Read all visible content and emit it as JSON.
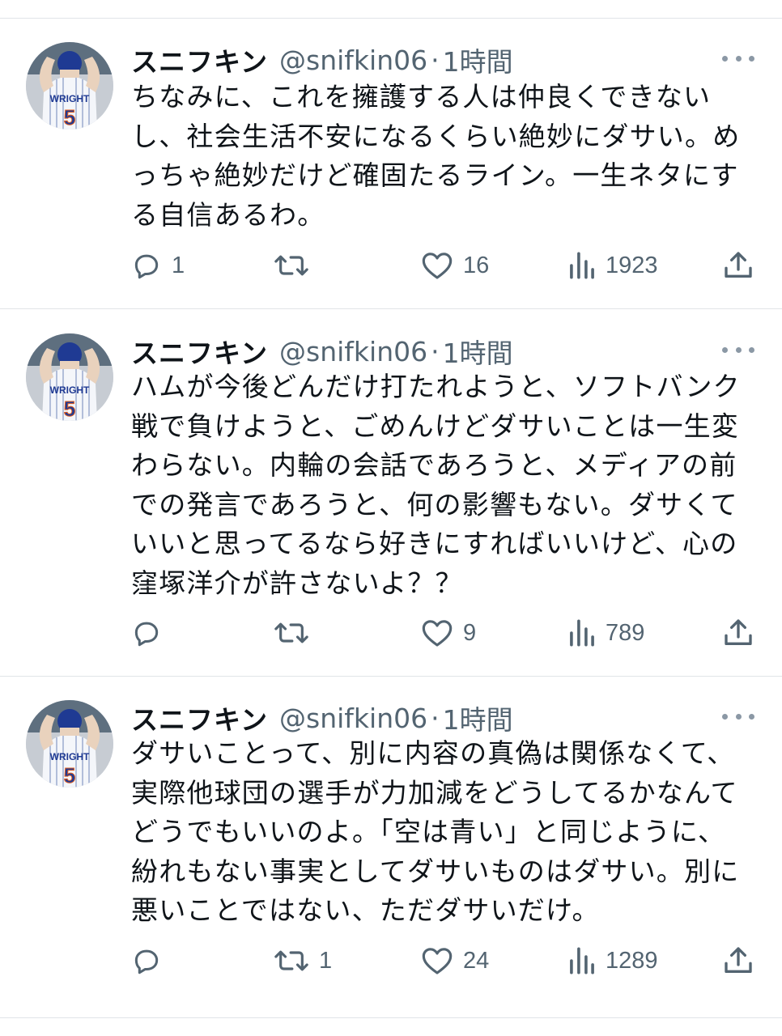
{
  "tweets": [
    {
      "name": "スニフキン",
      "handle": "@snifkin06",
      "separator": "·",
      "time": "1時間",
      "lines": [
        "ちなみに、これを擁護する人は仲良くできない",
        "し、社会生活不安になるくらい絶妙にダサい。め",
        "っちゃ絶妙だけど確固たるライン。一生ネタにす",
        "る自信あるわ。"
      ],
      "replies": "1",
      "retweets": "",
      "likes": "16",
      "views": "1923"
    },
    {
      "name": "スニフキン",
      "handle": "@snifkin06",
      "separator": "·",
      "time": "1時間",
      "lines": [
        "ハムが今後どんだけ打たれようと、ソフトバンク",
        "戦で負けようと、ごめんけどダサいことは一生変",
        "わらない。内輪の会話であろうと、メディアの前",
        "での発言であろうと、何の影響もない。ダサくて",
        "いいと思ってるなら好きにすればいいけど、心の",
        "窪塚洋介が許さないよ？？"
      ],
      "replies": "",
      "retweets": "",
      "likes": "9",
      "views": "789"
    },
    {
      "name": "スニフキン",
      "handle": "@snifkin06",
      "separator": "·",
      "time": "1時間",
      "lines": [
        "ダサいことって、別に内容の真偽は関係なくて、",
        "実際他球団の選手が力加減をどうしてるかなんて",
        "どうでもいいのよ。「空は青い」と同じように、",
        "紛れもない事実としてダサいものはダサい。別に",
        "悪いことではない、ただダサいだけ。"
      ],
      "replies": "",
      "retweets": "1",
      "likes": "24",
      "views": "1289"
    }
  ],
  "avatar": {
    "jersey_name": "WRIGHT",
    "jersey_number": "5"
  },
  "icons": [
    "reply-icon",
    "retweet-icon",
    "like-icon",
    "views-icon",
    "share-icon",
    "more-icon"
  ],
  "colors": {
    "text": "#0f1419",
    "muted": "#536471",
    "divider": "#e1e4e8"
  }
}
